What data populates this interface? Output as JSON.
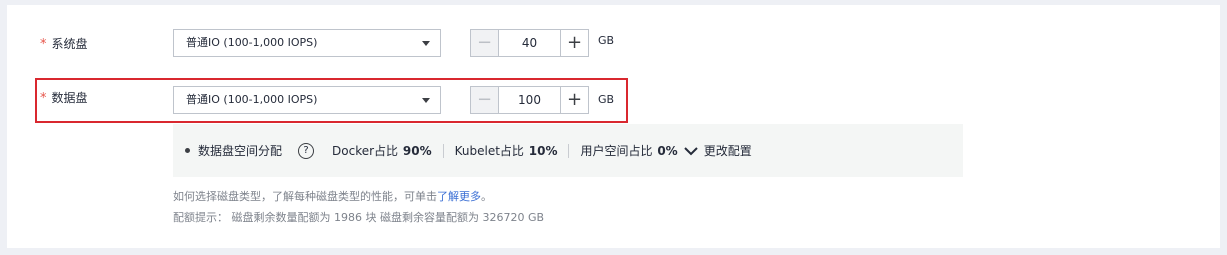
{
  "system_disk": {
    "label": "系统盘",
    "required_mark": "*",
    "type": "普通IO (100-1,000 IOPS)",
    "size": "40",
    "unit": "GB",
    "minus": "−",
    "plus": "+"
  },
  "data_disk": {
    "label": "数据盘",
    "required_mark": "*",
    "type": "普通IO (100-1,000 IOPS)",
    "size": "100",
    "unit": "GB",
    "minus": "−",
    "plus": "+",
    "highlight_color": "#d9282f"
  },
  "allocation": {
    "title": "数据盘空间分配",
    "help": "?",
    "docker_label": "Docker占比",
    "docker_pct": "90%",
    "kubelet_label": "Kubelet占比",
    "kubelet_pct": "10%",
    "user_label": "用户空间占比",
    "user_pct": "0%",
    "change_link": "更改配置"
  },
  "hints": {
    "disk_type_text": "如何选择磁盘类型，了解每种磁盘类型的性能，可单击",
    "learn_more": "了解更多",
    "disk_type_end": "。",
    "quota": "配额提示： 磁盘剩余数量配额为 1986 块 磁盘剩余容量配额为 326720 GB"
  },
  "colors": {
    "required": "#e6554a",
    "link": "#3b6fd4",
    "border": "#bfc4cc"
  }
}
